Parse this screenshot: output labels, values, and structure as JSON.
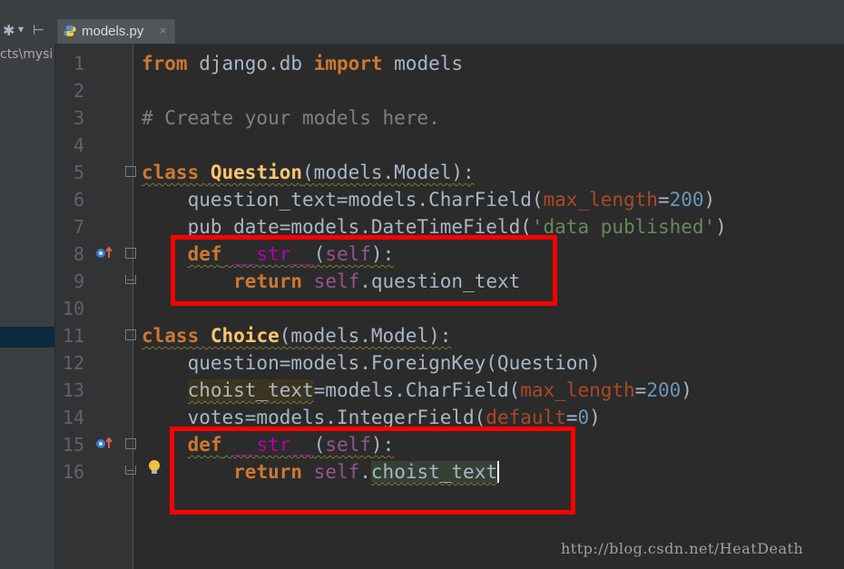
{
  "project_panel": {
    "path_fragment": "cts\\mysi"
  },
  "editor_tab": {
    "filename": "models.py",
    "close_glyph": "×",
    "icon": "python-file-icon"
  },
  "icons": {
    "gear": "gear-icon",
    "pin": "pin-icon",
    "override": "override-method-icon",
    "intention": "lightbulb-icon"
  },
  "colors": {
    "keyword": "#cc7832",
    "class_name": "#ffc66d",
    "comment": "#808080",
    "string": "#6a8759",
    "number": "#6897bb",
    "self": "#94558d",
    "magic": "#b200b2",
    "annotation_box": "#ff0000"
  },
  "code": {
    "line_numbers": [
      "1",
      "2",
      "3",
      "4",
      "5",
      "6",
      "7",
      "8",
      "9",
      "10",
      "11",
      "12",
      "13",
      "14",
      "15",
      "16"
    ],
    "l1": {
      "from": "from",
      "mod": " django.db ",
      "import": "import",
      "name": " models"
    },
    "l3": {
      "comment": "# Create your models here."
    },
    "l5": {
      "kw": "class",
      "sp": " ",
      "name": "Question",
      "rest": "(models.Model):"
    },
    "l6": {
      "a": "    question_text=models.CharField(",
      "p": "max_length",
      "eq": "=",
      "n": "200",
      "c": ")"
    },
    "l7": {
      "a": "    pub_date=models.DateTimeField(",
      "s": "'data published'",
      "c": ")"
    },
    "l8": {
      "ind": "    ",
      "kw": "def",
      "sp": " ",
      "magic": "__str__",
      "o": "(",
      "self": "self",
      "c": "):"
    },
    "l9": {
      "ind": "        ",
      "kw": "return",
      "sp": " ",
      "self": "self",
      "rest": ".question_text"
    },
    "l11": {
      "kw": "class",
      "sp": " ",
      "name": "Choice",
      "rest": "(models.Model):"
    },
    "l12": {
      "a": "    question=models.ForeignKey(Question)"
    },
    "l13": {
      "ind": "    ",
      "var": "choist_text",
      "a": "=models.CharField(",
      "p": "max_length",
      "eq": "=",
      "n": "200",
      "c": ")"
    },
    "l14": {
      "a": "    votes=models.IntegerField(",
      "p": "default",
      "eq": "=",
      "n": "0",
      "c": ")"
    },
    "l15": {
      "ind": "    ",
      "kw": "def",
      "sp": " ",
      "magic": "__str__",
      "o": "(",
      "self": "self",
      "c": "):"
    },
    "l16": {
      "ind": "        ",
      "kw": "return",
      "sp": " ",
      "self": "self",
      "dot": ".",
      "attr": "choist_text"
    }
  },
  "watermark": "http://blog.csdn.net/HeatDeath"
}
